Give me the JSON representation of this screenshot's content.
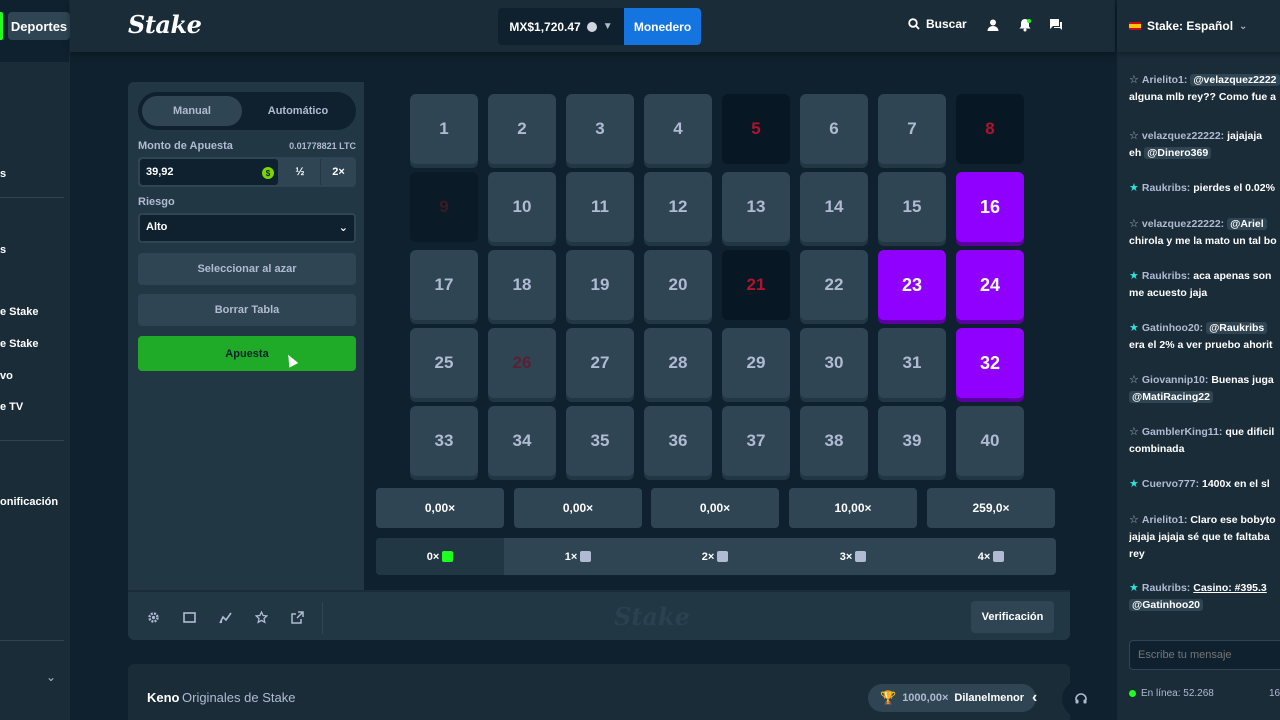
{
  "header": {
    "logo": "Stake",
    "balance": "MX$1,720.47",
    "wallet_label": "Monedero",
    "search_label": "Buscar"
  },
  "left_sidebar": {
    "sports_tab": "Deportes",
    "items": [
      "s",
      "s",
      "e Stake",
      "e Stake",
      "vo",
      "e TV",
      "onificación"
    ]
  },
  "bet_panel": {
    "mode_manual": "Manual",
    "mode_auto": "Automático",
    "bet_amount_label": "Monto de Apuesta",
    "bet_amount_crypto": "0.01778821 LTC",
    "bet_amount_value": "39,92",
    "half_label": "½",
    "double_label": "2×",
    "risk_label": "Riesgo",
    "risk_value": "Alto",
    "random_label": "Seleccionar al azar",
    "clear_label": "Borrar Tabla",
    "bet_label": "Apuesta"
  },
  "grid": {
    "tiles": [
      {
        "n": "1",
        "state": "normal"
      },
      {
        "n": "2",
        "state": "normal"
      },
      {
        "n": "3",
        "state": "normal"
      },
      {
        "n": "4",
        "state": "normal"
      },
      {
        "n": "5",
        "state": "miss"
      },
      {
        "n": "6",
        "state": "normal"
      },
      {
        "n": "7",
        "state": "normal"
      },
      {
        "n": "8",
        "state": "miss"
      },
      {
        "n": "9",
        "state": "hit-dark"
      },
      {
        "n": "10",
        "state": "normal"
      },
      {
        "n": "11",
        "state": "normal"
      },
      {
        "n": "12",
        "state": "normal"
      },
      {
        "n": "13",
        "state": "normal"
      },
      {
        "n": "14",
        "state": "normal"
      },
      {
        "n": "15",
        "state": "normal"
      },
      {
        "n": "16",
        "state": "selected"
      },
      {
        "n": "17",
        "state": "normal"
      },
      {
        "n": "18",
        "state": "normal"
      },
      {
        "n": "19",
        "state": "normal"
      },
      {
        "n": "20",
        "state": "normal"
      },
      {
        "n": "21",
        "state": "miss"
      },
      {
        "n": "22",
        "state": "normal"
      },
      {
        "n": "23",
        "state": "selected"
      },
      {
        "n": "24",
        "state": "selected"
      },
      {
        "n": "25",
        "state": "normal"
      },
      {
        "n": "26",
        "state": "miss-light"
      },
      {
        "n": "27",
        "state": "normal"
      },
      {
        "n": "28",
        "state": "normal"
      },
      {
        "n": "29",
        "state": "normal"
      },
      {
        "n": "30",
        "state": "normal"
      },
      {
        "n": "31",
        "state": "normal"
      },
      {
        "n": "32",
        "state": "selected"
      },
      {
        "n": "33",
        "state": "normal"
      },
      {
        "n": "34",
        "state": "normal"
      },
      {
        "n": "35",
        "state": "normal"
      },
      {
        "n": "36",
        "state": "normal"
      },
      {
        "n": "37",
        "state": "normal"
      },
      {
        "n": "38",
        "state": "normal"
      },
      {
        "n": "39",
        "state": "normal"
      },
      {
        "n": "40",
        "state": "normal"
      }
    ],
    "multipliers": [
      "0,00×",
      "0,00×",
      "0,00×",
      "10,00×",
      "259,0×"
    ],
    "hits": [
      "0×",
      "1×",
      "2×",
      "3×",
      "4×"
    ]
  },
  "bottom_bar": {
    "watermark": "Stake",
    "verify_label": "Verificación"
  },
  "game_info": {
    "title": "Keno",
    "subtitle": "Originales de Stake",
    "top_win_multiplier": "1000,00×",
    "top_win_user": "Dilanelmenor"
  },
  "chat": {
    "language": "Stake: Español",
    "messages": [
      {
        "user": "Arielito1:",
        "parts": [
          {
            "t": "mention",
            "v": "@velazquez2222"
          }
        ],
        "line2": "alguna mlb rey?? Como fue a",
        "teal": false
      },
      {
        "user": "velazquez22222:",
        "parts": [
          {
            "t": "text",
            "v": "jajajaja"
          }
        ],
        "line2_parts": [
          {
            "t": "text",
            "v": "eh "
          },
          {
            "t": "mention",
            "v": "@Dinero369"
          }
        ],
        "teal": false
      },
      {
        "user": "Raukribs:",
        "parts": [
          {
            "t": "text",
            "v": "pierdes el 0.02%"
          }
        ],
        "teal": true
      },
      {
        "user": "velazquez22222:",
        "parts": [
          {
            "t": "mention",
            "v": "@Ariel"
          }
        ],
        "line2": "chirola y me la mato un tal bo",
        "teal": false
      },
      {
        "user": "Raukribs:",
        "parts": [
          {
            "t": "text",
            "v": "aca apenas son"
          }
        ],
        "line2": "me acuesto jaja",
        "teal": true
      },
      {
        "user": "Gatinhoo20:",
        "parts": [
          {
            "t": "mention",
            "v": "@Raukribs"
          }
        ],
        "line2": "era el 2% a ver pruebo ahorit",
        "teal": true
      },
      {
        "user": "Giovannip10:",
        "parts": [
          {
            "t": "text",
            "v": "Buenas juga"
          }
        ],
        "line2_parts": [
          {
            "t": "mention",
            "v": "@MatiRacing22"
          }
        ],
        "teal": false
      },
      {
        "user": "GamblerKing11:",
        "parts": [
          {
            "t": "text",
            "v": "que dificil"
          }
        ],
        "line2": "combinada",
        "teal": false
      },
      {
        "user": "Cuervo777:",
        "parts": [
          {
            "t": "text",
            "v": "1400x en el sl"
          }
        ],
        "teal": true
      },
      {
        "user": "Arielito1:",
        "parts": [
          {
            "t": "text",
            "v": "Claro ese bobyto"
          }
        ],
        "line2": "jajaja jajaja sé que te faltaba",
        "line3": "rey",
        "teal": false
      },
      {
        "user": "Raukribs:",
        "parts": [
          {
            "t": "link",
            "v": "Casino: #395.3"
          }
        ],
        "line2_parts": [
          {
            "t": "mention",
            "v": "@Gatinhoo20"
          }
        ],
        "teal": true
      }
    ],
    "input_placeholder": "Escribe tu mensaje",
    "online_label": "En línea: 52.268",
    "online_extra": "16"
  },
  "colors": {
    "bg": "#0f212e",
    "panel": "#213743",
    "tile": "#2f4553",
    "selected": "#9000ff",
    "accent_green": "#1fab28",
    "wallet_blue": "#1475e1",
    "miss_red": "#b0132d"
  }
}
